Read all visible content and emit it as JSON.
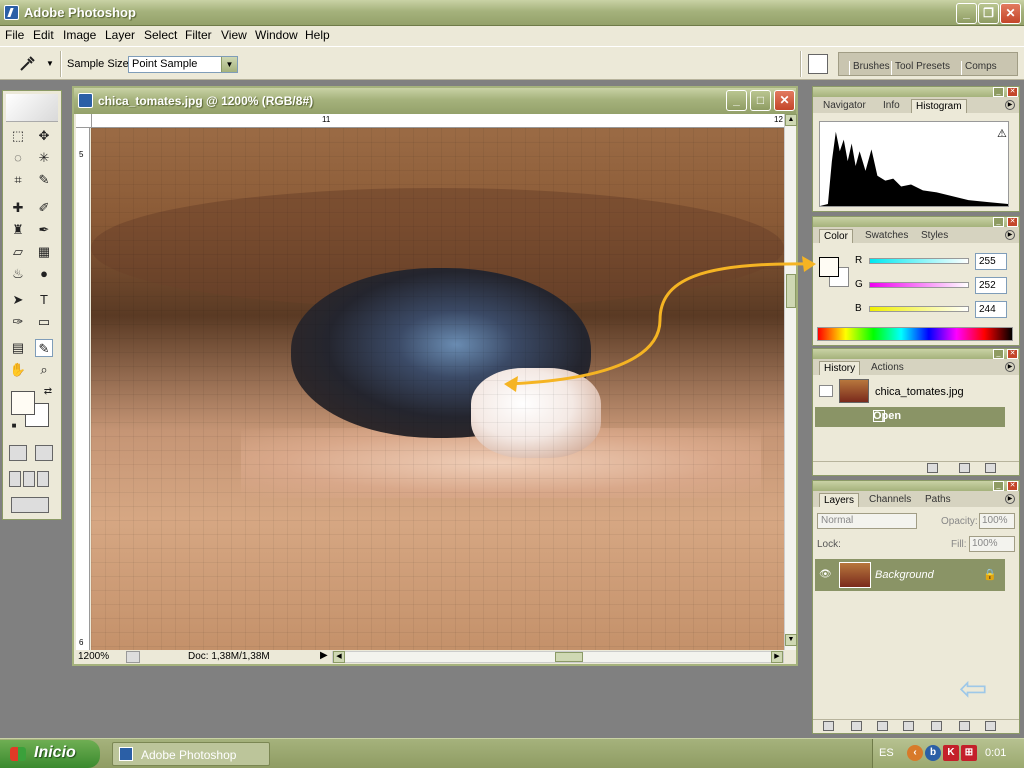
{
  "app": {
    "title": "Adobe Photoshop"
  },
  "menu": [
    "File",
    "Edit",
    "Image",
    "Layer",
    "Select",
    "Filter",
    "View",
    "Window",
    "Help"
  ],
  "options": {
    "sample_size_label": "Sample Size:",
    "sample_size_value": "Point Sample",
    "well_tabs": [
      "Brushes",
      "Tool Presets",
      "Comps"
    ]
  },
  "document": {
    "title": "chica_tomates.jpg @ 1200% (RGB/8#)",
    "ruler_top": [
      "11",
      "12"
    ],
    "ruler_left": [
      "5",
      "6"
    ],
    "zoom": "1200%",
    "doc_size": "Doc: 1,38M/1,38M"
  },
  "navigator": {
    "tabs": [
      "Navigator",
      "Info",
      "Histogram"
    ],
    "active": "Histogram",
    "warning_icon": "warning-icon"
  },
  "color": {
    "tabs": [
      "Color",
      "Swatches",
      "Styles"
    ],
    "channels": [
      {
        "label": "R",
        "value": "255",
        "color": "#00d8e0"
      },
      {
        "label": "G",
        "value": "252",
        "color": "#e000e0"
      },
      {
        "label": "B",
        "value": "244",
        "color": "#e8e000"
      }
    ],
    "fg_color": "#fffcf4"
  },
  "history": {
    "tabs": [
      "History",
      "Actions"
    ],
    "snapshot": "chica_tomates.jpg",
    "states": [
      "Open"
    ]
  },
  "layers": {
    "tabs": [
      "Layers",
      "Channels",
      "Paths"
    ],
    "blend_mode": "Normal",
    "opacity_label": "Opacity:",
    "opacity": "100%",
    "lock_label": "Lock:",
    "fill_label": "Fill:",
    "fill": "100%",
    "layer_name": "Background"
  },
  "taskbar": {
    "start": "Inicio",
    "task": "Adobe Photoshop",
    "lang": "ES",
    "clock": "0:01"
  },
  "colors": {
    "accent": "#a5b27c",
    "arrow": "#f5b423",
    "selected_row": "#8a9466"
  }
}
